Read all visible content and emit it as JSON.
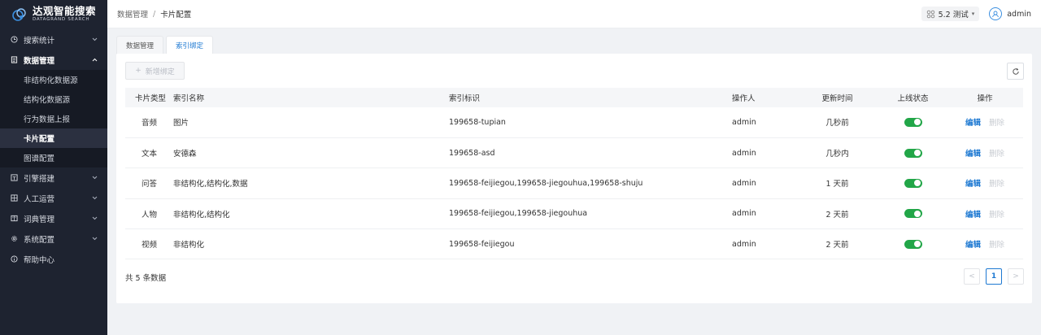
{
  "app": {
    "logo_title": "达观智能搜索",
    "logo_sub": "DATAGRAND SEARCH"
  },
  "sidebar": {
    "items": [
      {
        "label": "搜索统计",
        "icon": "clock-icon"
      },
      {
        "label": "数据管理",
        "icon": "document-icon",
        "open": true
      },
      {
        "label": "引擎搭建",
        "icon": "engine-icon"
      },
      {
        "label": "人工运营",
        "icon": "grid-icon"
      },
      {
        "label": "词典管理",
        "icon": "book-icon"
      },
      {
        "label": "系统配置",
        "icon": "gear-icon"
      },
      {
        "label": "帮助中心",
        "icon": "info-icon"
      }
    ],
    "sub_items": [
      {
        "label": "非结构化数据源"
      },
      {
        "label": "结构化数据源"
      },
      {
        "label": "行为数据上报"
      },
      {
        "label": "卡片配置",
        "active": true
      },
      {
        "label": "图谱配置"
      }
    ]
  },
  "header": {
    "breadcrumb_parent": "数据管理",
    "breadcrumb_sep": "/",
    "breadcrumb_current": "卡片配置",
    "version": "5.2 测试",
    "user": "admin"
  },
  "tabs": [
    {
      "label": "数据管理",
      "active": false
    },
    {
      "label": "索引绑定",
      "active": true
    }
  ],
  "toolbar": {
    "add_label": "新增绑定"
  },
  "table": {
    "columns": [
      "卡片类型",
      "索引名称",
      "索引标识",
      "操作人",
      "更新时间",
      "上线状态",
      "操作"
    ],
    "rows": [
      {
        "type": "音频",
        "name": "图片",
        "id": "199658-tupian",
        "operator": "admin",
        "updated": "几秒前",
        "online": true
      },
      {
        "type": "文本",
        "name": "安德森",
        "id": "199658-asd",
        "operator": "admin",
        "updated": "几秒内",
        "online": true
      },
      {
        "type": "问答",
        "name": "非结构化,结构化,数据",
        "id": "199658-feijiegou,199658-jiegouhua,199658-shuju",
        "operator": "admin",
        "updated": "1 天前",
        "online": true
      },
      {
        "type": "人物",
        "name": "非结构化,结构化",
        "id": "199658-feijiegou,199658-jiegouhua",
        "operator": "admin",
        "updated": "2 天前",
        "online": true
      },
      {
        "type": "视频",
        "name": "非结构化",
        "id": "199658-feijiegou",
        "operator": "admin",
        "updated": "2 天前",
        "online": true
      }
    ],
    "action_edit": "编辑",
    "action_delete": "删除"
  },
  "footer": {
    "count_text": "共 5 条数据",
    "current_page": "1",
    "prev": "<",
    "next": ">"
  },
  "colors": {
    "sidebar_bg": "#1e2330",
    "accent": "#1e79d2",
    "toggle_on": "#22a648"
  }
}
